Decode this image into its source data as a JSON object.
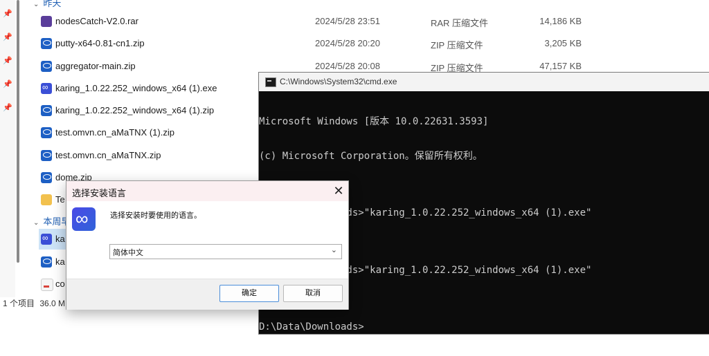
{
  "explorer": {
    "groups": [
      {
        "label": "昨天"
      },
      {
        "label": "本周早"
      }
    ],
    "files": [
      {
        "name": "nodesCatch-V2.0.rar",
        "date": "2024/5/28 23:51",
        "type": "RAR 压缩文件",
        "size": "14,186 KB",
        "icon": "rar-icon"
      },
      {
        "name": "putty-x64-0.81-cn1.zip",
        "date": "2024/5/28 20:20",
        "type": "ZIP 压缩文件",
        "size": "3,205 KB",
        "icon": "zip-icon"
      },
      {
        "name": "aggregator-main.zip",
        "date": "2024/5/28 20:08",
        "type": "ZIP 压缩文件",
        "size": "47,157 KB",
        "icon": "zip-icon"
      },
      {
        "name": "karing_1.0.22.252_windows_x64 (1).exe",
        "icon": "karing-app-icon"
      },
      {
        "name": "karing_1.0.22.252_windows_x64 (1).zip",
        "icon": "zip-icon"
      },
      {
        "name": "test.omvn.cn_aMaTNX (1).zip",
        "icon": "zip-icon"
      },
      {
        "name": "test.omvn.cn_aMaTNX.zip",
        "icon": "zip-icon"
      },
      {
        "name": "dome.zip",
        "icon": "zip-icon"
      },
      {
        "name": "Te",
        "icon": "folder-icon"
      }
    ],
    "week_files": [
      {
        "name": "ka",
        "icon": "karing-app-icon",
        "selected": true
      },
      {
        "name": "ka",
        "icon": "zip-icon"
      },
      {
        "name": "co",
        "icon": "pdf-icon"
      }
    ],
    "status": {
      "count": "1 个项目",
      "size": "36.0 M"
    }
  },
  "cmd": {
    "title": "C:\\Windows\\System32\\cmd.exe",
    "lines": [
      "Microsoft Windows [版本 10.0.22631.3593]",
      "(c) Microsoft Corporation。保留所有权利。",
      "",
      "D:\\Data\\Downloads>\"karing_1.0.22.252_windows_x64 (1).exe\"",
      "",
      "D:\\Data\\Downloads>\"karing_1.0.22.252_windows_x64 (1).exe\"",
      "",
      "D:\\Data\\Downloads>"
    ]
  },
  "dialog": {
    "title": "选择安装语言",
    "close": "✕",
    "prompt": "选择安装时要使用的语言。",
    "selected_language": "简体中文",
    "ok_label": "确定",
    "cancel_label": "取消"
  }
}
